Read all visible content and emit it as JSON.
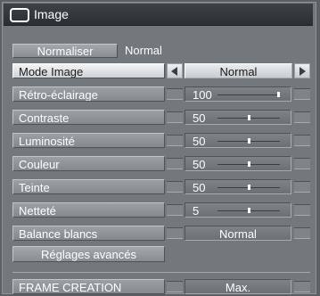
{
  "title": "Image",
  "normaliser": {
    "button_label": "Normaliser",
    "value": "Normal"
  },
  "rows": [
    {
      "label": "Mode Image",
      "type": "select",
      "value": "Normal"
    },
    {
      "label": "Rétro-éclairage",
      "type": "slider",
      "value": "100",
      "level": 1.0
    },
    {
      "label": "Contraste",
      "type": "slider",
      "value": "50",
      "level": 0.5
    },
    {
      "label": "Luminosité",
      "type": "slider",
      "value": "50",
      "level": 0.5
    },
    {
      "label": "Couleur",
      "type": "slider",
      "value": "50",
      "level": 0.5
    },
    {
      "label": "Teinte",
      "type": "slider",
      "value": "50",
      "level": 0.5
    },
    {
      "label": "Netteté",
      "type": "slider",
      "value": "5",
      "level": 0.5
    },
    {
      "label": "Balance blancs",
      "type": "select",
      "value": "Normal"
    }
  ],
  "advanced_button": "Réglages avancés",
  "frame_creation": {
    "label": "FRAME CREATION",
    "value": "Max."
  },
  "colors": {
    "panel": "#72787c",
    "title_bar": "#2f3438",
    "selected": "#e6e8ea",
    "text": "#ffffff"
  }
}
